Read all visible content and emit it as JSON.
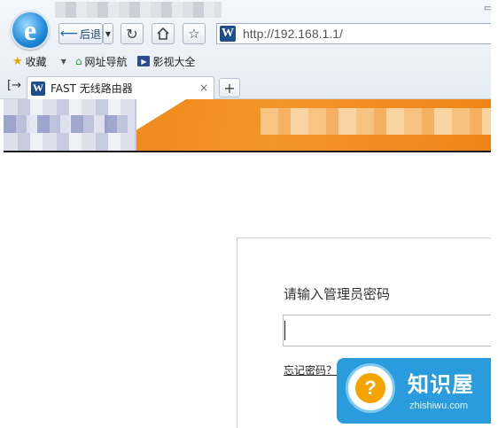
{
  "browser": {
    "logo_letter": "e",
    "nav": {
      "back_label": "后退",
      "back_arrow_icon": "arrow-left-icon",
      "refresh_icon": "refresh-icon",
      "home_icon": "home-icon",
      "favorite_icon": "star-icon"
    },
    "address": {
      "favicon_letter": "W",
      "url": "http://192.168.1.1/"
    },
    "favorites_bar": {
      "collect_label": "收藏",
      "site_nav_label": "网址导航",
      "video_label": "影视大全"
    },
    "tab": {
      "favicon_letter": "W",
      "title": "FAST 无线路由器",
      "close_glyph": "×",
      "new_tab_glyph": "+"
    },
    "colors": {
      "banner_orange": "#f08a1c",
      "ie_blue": "#1e88d8"
    }
  },
  "login": {
    "prompt": "请输入管理员密码",
    "password_value": "",
    "forgot_link": "忘记密码？"
  },
  "watermark": {
    "site_name": "知识屋",
    "domain": "zhishiwu.com",
    "icon_glyph": "?"
  }
}
